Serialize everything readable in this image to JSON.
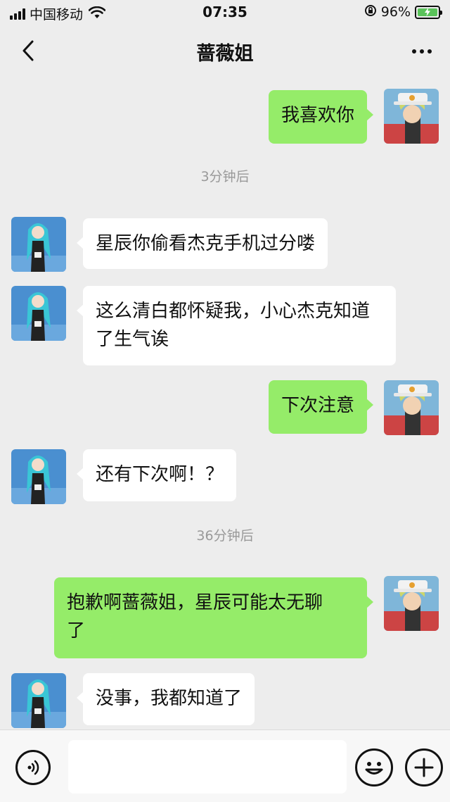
{
  "status_bar": {
    "carrier": "中国移动",
    "time": "07:35",
    "battery_percent": "96%",
    "signal_icon": "signal-bars-icon",
    "wifi_icon": "wifi-icon",
    "lock_icon": "rotation-lock-icon",
    "battery_icon": "battery-charging-icon"
  },
  "nav": {
    "title": "蔷薇姐",
    "back_icon": "chevron-left-icon",
    "more_icon": "more-dots-icon"
  },
  "messages": [
    {
      "side": "right",
      "text": "我喜欢你"
    },
    {
      "type": "time",
      "text": "3分钟后"
    },
    {
      "side": "left",
      "text": "星辰你偷看杰克手机过分喽"
    },
    {
      "side": "left",
      "text_line1": "这么清白都怀疑我，小心杰克知道",
      "text_line2": "了生气诶"
    },
    {
      "side": "right",
      "text": "下次注意"
    },
    {
      "side": "left",
      "text": "还有下次啊！？"
    },
    {
      "type": "time",
      "text": "36分钟后"
    },
    {
      "side": "right",
      "text_line1": "抱歉啊蔷薇姐，星辰可能太无聊",
      "text_line2": "了"
    },
    {
      "side": "left",
      "text": "没事，我都知道了"
    }
  ],
  "input_bar": {
    "voice_icon": "voice-icon",
    "input_value": "",
    "emoji_icon": "emoji-icon",
    "plus_icon": "plus-icon"
  },
  "colors": {
    "background": "#ededed",
    "my_bubble": "#95ec69",
    "their_bubble": "#ffffff",
    "time_text": "#999999"
  }
}
